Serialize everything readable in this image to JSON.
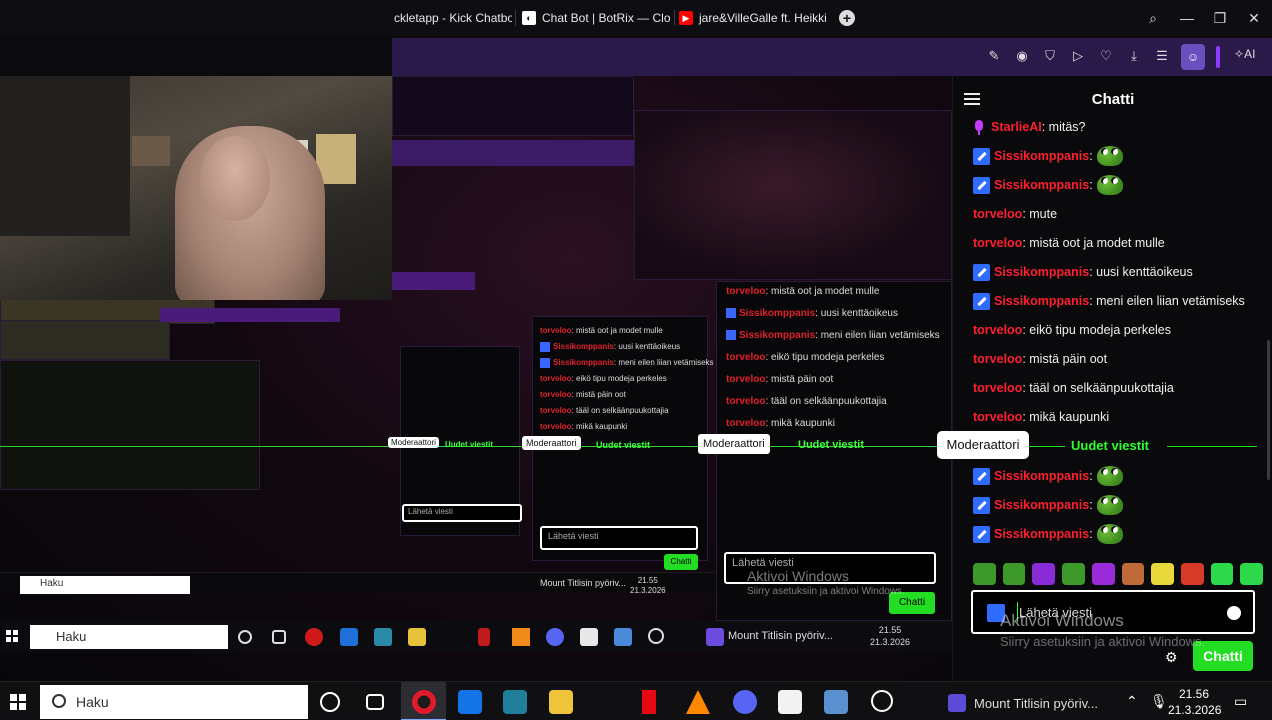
{
  "browser": {
    "tabs": [
      {
        "label": "ckletapp - Kick Chatbot",
        "fav_color": "#ffffff"
      },
      {
        "label": "Chat Bot | BotRix — Cloud",
        "fav_color": "#ffffff"
      },
      {
        "label": "jare&VilleGalle ft. Heikki K",
        "fav_color": "#ff0000"
      }
    ],
    "new_tab": "+",
    "window_controls": {
      "search": "⌕",
      "minimize": "—",
      "maximize": "❐",
      "close": "✕"
    },
    "toolbar": {
      "ai_label": "AI"
    }
  },
  "chat": {
    "title": "Chatti",
    "messages": [
      {
        "badge": "mic",
        "user": "StarlieAI",
        "text": ": mitäs?",
        "emote": false
      },
      {
        "badge": "mod",
        "user": "Sissikomppanis",
        "text": ":",
        "emote": true
      },
      {
        "badge": "mod",
        "user": "Sissikomppanis",
        "text": ":",
        "emote": true
      },
      {
        "badge": "none",
        "user": "torveloo",
        "text": ": mute",
        "emote": false
      },
      {
        "badge": "none",
        "user": "torveloo",
        "text": ": mistä oot ja modet mulle",
        "emote": false
      },
      {
        "badge": "mod",
        "user": "Sissikomppanis",
        "text": ": uusi kenttäoikeus",
        "emote": false
      },
      {
        "badge": "mod",
        "user": "Sissikomppanis",
        "text": ": meni eilen liian vetämiseks",
        "emote": false
      },
      {
        "badge": "none",
        "user": "torveloo",
        "text": ": eikö tipu modeja perkeles",
        "emote": false
      },
      {
        "badge": "none",
        "user": "torveloo",
        "text": ": mistä päin oot",
        "emote": false
      },
      {
        "badge": "none",
        "user": "torveloo",
        "text": ": tääl on selkäänpuukottajia",
        "emote": false
      },
      {
        "badge": "none",
        "user": "torveloo",
        "text": ": mikä kaupunki",
        "emote": false
      },
      {
        "badge": "mod",
        "user": "Sissikomppanis",
        "text": ":",
        "emote": true
      },
      {
        "badge": "mod",
        "user": "Sissikomppanis",
        "text": ":",
        "emote": true
      },
      {
        "badge": "mod",
        "user": "Sissikomppanis",
        "text": ":",
        "emote": true
      }
    ],
    "moderator_tag": "Moderaattori",
    "new_messages_label": "Uudet viestit",
    "input_placeholder": "Lähetä viesti",
    "send_label": "Chatti",
    "emote_colors": [
      "#3d9a2a",
      "#3d9a2a",
      "#8a2bd8",
      "#3d9a2a",
      "#9b2bd8",
      "#c06a3a",
      "#e8d83a",
      "#d83a2a",
      "#2dd84a",
      "#2dd84a"
    ]
  },
  "overlay": {
    "watermark_title": "Aktivoi Windows",
    "watermark_sub": "Siirry asetuksiin ja aktivoi Windows.",
    "mini_tag": "Moderaattori",
    "mini_new": "Uudet viestit",
    "mini_input": "Lähetä viesti",
    "mini_send": "Chatti"
  },
  "nested_taskbar": {
    "search_label": "Haku",
    "task_label": "Mount Titlisin pyöriv...",
    "time": "21.55",
    "date": "21.3.2026"
  },
  "taskbar": {
    "search_label": "Haku",
    "task_label": "Mount Titlisin pyöriv...",
    "time": "21.56",
    "date": "21.3.2026"
  }
}
